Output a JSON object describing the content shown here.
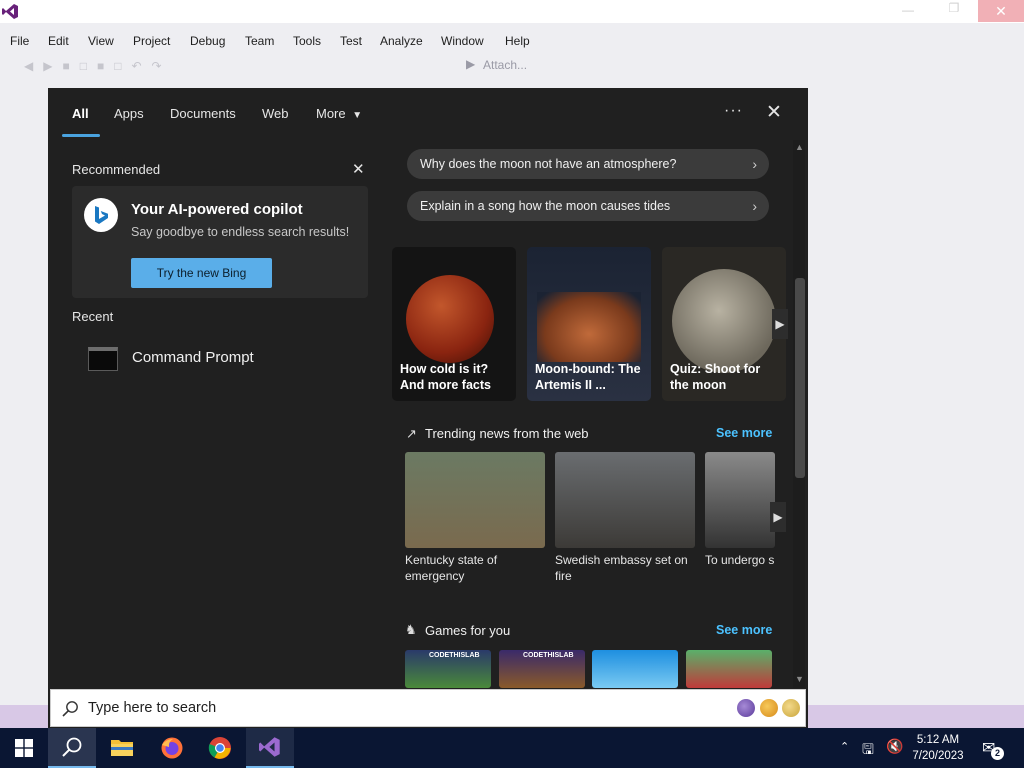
{
  "app": {
    "menu": [
      "File",
      "Edit",
      "View",
      "Project",
      "Debug",
      "Team",
      "Tools",
      "Test",
      "Analyze",
      "Window",
      "Help"
    ],
    "toolbar_attach": "Attach...",
    "accent": "#68217a"
  },
  "search_panel": {
    "tabs": [
      {
        "label": "All",
        "active": true
      },
      {
        "label": "Apps"
      },
      {
        "label": "Documents"
      },
      {
        "label": "Web"
      },
      {
        "label": "More"
      }
    ],
    "recommended": {
      "heading": "Recommended",
      "title": "Your AI-powered copilot",
      "subtitle": "Say goodbye to endless search results!",
      "button": "Try the new Bing"
    },
    "recent": {
      "heading": "Recent",
      "items": [
        {
          "label": "Command Prompt",
          "icon": "command-prompt-icon"
        }
      ]
    },
    "suggestions": [
      "Why does the moon not have an atmosphere?",
      "Explain in a song how the moon causes tides"
    ],
    "feature_cards": [
      {
        "caption": "How cold is it? And more facts"
      },
      {
        "caption": "Moon-bound: The Artemis II ..."
      },
      {
        "caption": "Quiz: Shoot for the moon"
      }
    ],
    "trending": {
      "heading": "Trending news from the web",
      "see_more": "See more",
      "items": [
        {
          "caption": "Kentucky state of emergency"
        },
        {
          "caption": "Swedish embassy set on fire"
        },
        {
          "caption": "To undergo su"
        }
      ]
    },
    "games": {
      "heading": "Games for you",
      "see_more": "See more",
      "items": [
        {
          "label": "CODETHISLAB"
        },
        {
          "label": "CODETHISLAB"
        },
        {
          "label": ""
        },
        {
          "label": ""
        }
      ]
    },
    "search_placeholder": "Type here to search",
    "accent": "#4cc2ff"
  },
  "taskbar": {
    "time": "5:12 AM",
    "date": "7/20/2023",
    "notification_count": "2"
  }
}
